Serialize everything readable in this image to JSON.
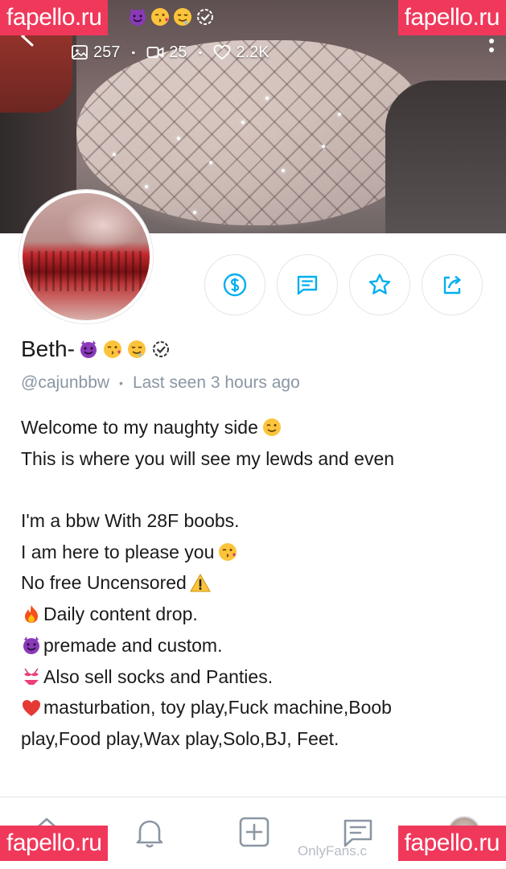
{
  "watermark": {
    "text": "fapello.ru"
  },
  "header": {
    "stats": [
      {
        "icon": "image-icon",
        "value": "257"
      },
      {
        "icon": "video-icon",
        "value": "25"
      },
      {
        "icon": "heart-icon",
        "value": "2.2K"
      }
    ],
    "separator": "•"
  },
  "profile": {
    "name": "Beth-",
    "name_emojis": [
      "smiling-devil-emoji",
      "kissing-face-emoji",
      "drooling-face-emoji"
    ],
    "verified": true,
    "handle": "@cajunbbw",
    "separator": "•",
    "last_seen": "Last seen 3 hours ago"
  },
  "actions": [
    {
      "name": "tip-button",
      "icon": "dollar-icon"
    },
    {
      "name": "message-button",
      "icon": "chat-icon"
    },
    {
      "name": "favorite-button",
      "icon": "star-icon"
    },
    {
      "name": "share-button",
      "icon": "share-icon"
    }
  ],
  "bio": {
    "lines": [
      "Welcome to my naughty side",
      "This is where you will see my lewds and even",
      "",
      "I'm a bbw With 28F boobs.",
      "I am here to please you",
      "No free Uncensored",
      "Daily content drop.",
      "premade and custom.",
      "Also sell socks and Panties.",
      " masturbation, toy play,Fuck machine,Boob",
      "play,Food play,Wax play,Solo,BJ, Feet."
    ]
  },
  "bottom_nav": {
    "items": [
      "home-icon",
      "bell-icon",
      "add-post-icon",
      "messages-icon",
      "profile-avatar"
    ],
    "site_text": "OnlyFans.c"
  },
  "colors": {
    "accent": "#00aff0",
    "muted": "#8a96a3",
    "watermark": "#f0385b"
  }
}
